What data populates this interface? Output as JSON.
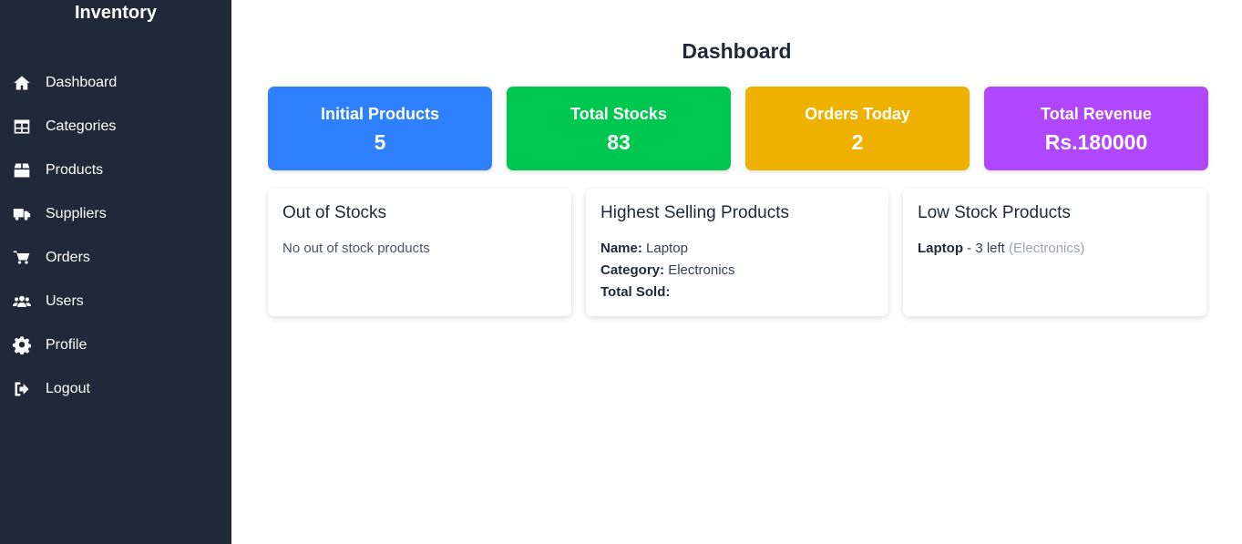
{
  "sidebar": {
    "brand": "Inventory",
    "items": [
      {
        "label": "Dashboard",
        "icon": "home-icon"
      },
      {
        "label": "Categories",
        "icon": "table-icon"
      },
      {
        "label": "Products",
        "icon": "box-icon"
      },
      {
        "label": "Suppliers",
        "icon": "truck-icon"
      },
      {
        "label": "Orders",
        "icon": "cart-icon"
      },
      {
        "label": "Users",
        "icon": "users-icon"
      },
      {
        "label": "Profile",
        "icon": "gear-icon"
      },
      {
        "label": "Logout",
        "icon": "logout-icon"
      }
    ]
  },
  "main": {
    "title": "Dashboard",
    "stats": [
      {
        "label": "Initial Products",
        "value": "5",
        "color": "#2f80fd"
      },
      {
        "label": "Total Stocks",
        "value": "83",
        "color": "#00c74f"
      },
      {
        "label": "Orders Today",
        "value": "2",
        "color": "#efb000"
      },
      {
        "label": "Total Revenue",
        "value": "Rs.180000",
        "color": "#b146ff"
      }
    ],
    "out_of_stocks": {
      "title": "Out of Stocks",
      "message": "No out of stock products"
    },
    "highest_selling": {
      "title": "Highest Selling Products",
      "name_label": "Name:",
      "name_value": "Laptop",
      "category_label": "Category:",
      "category_value": "Electronics",
      "total_sold_label": "Total Sold:",
      "total_sold_value": ""
    },
    "low_stock": {
      "title": "Low Stock Products",
      "items": [
        {
          "name": "Laptop",
          "detail": "- 3 left",
          "category": "(Electronics)"
        }
      ]
    }
  }
}
